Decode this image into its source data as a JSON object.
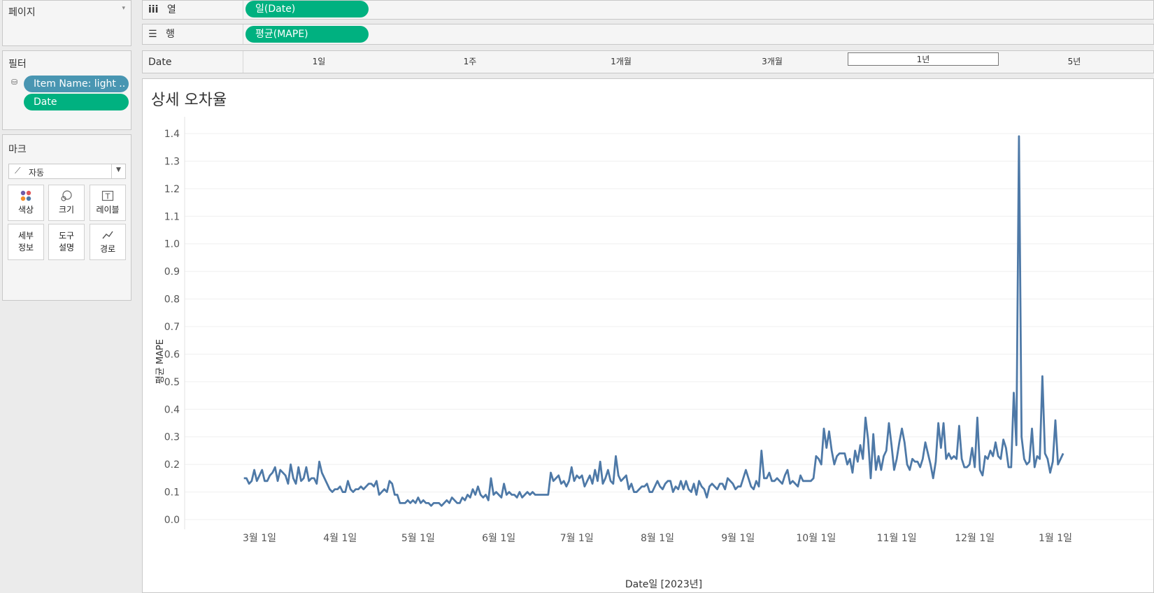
{
  "pages_panel": {
    "title": "페이지"
  },
  "filters_panel": {
    "title": "필터",
    "pills": [
      "Item Name: light ..",
      "Date"
    ]
  },
  "marks_panel": {
    "title": "마크",
    "type_value": "자동",
    "buttons": {
      "color": "색상",
      "size": "크기",
      "label": "레이블",
      "detail": [
        "세부",
        "정보"
      ],
      "tooltip": [
        "도구",
        "설명"
      ],
      "path": "경로"
    }
  },
  "columns_shelf": {
    "icon": "iii",
    "label": "열",
    "pill": "일(Date)"
  },
  "rows_shelf": {
    "icon": "☰",
    "label": "행",
    "pill": "평균(MAPE)"
  },
  "date_slider": {
    "label": "Date",
    "options": [
      "1일",
      "1주",
      "1개월",
      "3개월",
      "1년",
      "5년"
    ],
    "selected_index": 4
  },
  "worksheet": {
    "title": "상세 오차율"
  },
  "colors": {
    "line": "#4e79a7",
    "green_pill": "#00b180",
    "blue_pill": "#4996b2"
  },
  "chart_data": {
    "type": "line",
    "xlabel": "Date일 [2023년]",
    "ylabel": "평균 MAPE",
    "ylim": [
      0,
      1.45
    ],
    "yticks": [
      "0.0",
      "0.1",
      "0.2",
      "0.3",
      "0.4",
      "0.5",
      "0.6",
      "0.7",
      "0.8",
      "0.9",
      "1.0",
      "1.1",
      "1.2",
      "1.3",
      "1.4"
    ],
    "xticks": [
      {
        "label": "3월 1일",
        "date": "2023-03-01"
      },
      {
        "label": "4월 1일",
        "date": "2023-04-01"
      },
      {
        "label": "5월 1일",
        "date": "2023-05-01"
      },
      {
        "label": "6월 1일",
        "date": "2023-06-01"
      },
      {
        "label": "7월 1일",
        "date": "2023-07-01"
      },
      {
        "label": "8월 1일",
        "date": "2023-08-01"
      },
      {
        "label": "9월 1일",
        "date": "2023-09-01"
      },
      {
        "label": "10월 1일",
        "date": "2023-10-01"
      },
      {
        "label": "11월 1일",
        "date": "2023-11-01"
      },
      {
        "label": "12월 1일",
        "date": "2023-12-01"
      },
      {
        "label": "1월 1일",
        "date": "2024-01-01"
      }
    ],
    "series": [
      {
        "start_date": "2023-02-23",
        "values": [
          0.15,
          0.15,
          0.13,
          0.14,
          0.18,
          0.14,
          0.16,
          0.18,
          0.14,
          0.14,
          0.16,
          0.17,
          0.19,
          0.14,
          0.18,
          0.17,
          0.16,
          0.13,
          0.2,
          0.15,
          0.13,
          0.19,
          0.14,
          0.15,
          0.19,
          0.14,
          0.15,
          0.15,
          0.13,
          0.21,
          0.17,
          0.15,
          0.13,
          0.11,
          0.1,
          0.11,
          0.11,
          0.12,
          0.1,
          0.1,
          0.14,
          0.11,
          0.1,
          0.11,
          0.11,
          0.12,
          0.11,
          0.12,
          0.13,
          0.13,
          0.12,
          0.14,
          0.09,
          0.1,
          0.11,
          0.1,
          0.14,
          0.13,
          0.09,
          0.09,
          0.06,
          0.06,
          0.06,
          0.07,
          0.06,
          0.07,
          0.06,
          0.08,
          0.06,
          0.07,
          0.06,
          0.06,
          0.05,
          0.06,
          0.06,
          0.06,
          0.05,
          0.06,
          0.07,
          0.06,
          0.08,
          0.07,
          0.06,
          0.06,
          0.08,
          0.07,
          0.09,
          0.08,
          0.11,
          0.09,
          0.12,
          0.09,
          0.08,
          0.09,
          0.07,
          0.15,
          0.09,
          0.1,
          0.09,
          0.08,
          0.13,
          0.09,
          0.1,
          0.09,
          0.09,
          0.08,
          0.1,
          0.08,
          0.09,
          0.1,
          0.09,
          0.1,
          0.09,
          0.09,
          0.09,
          0.09,
          0.09,
          0.09,
          0.17,
          0.14,
          0.15,
          0.16,
          0.13,
          0.14,
          0.12,
          0.14,
          0.19,
          0.14,
          0.16,
          0.15,
          0.16,
          0.12,
          0.14,
          0.16,
          0.13,
          0.18,
          0.14,
          0.21,
          0.13,
          0.15,
          0.18,
          0.14,
          0.13,
          0.23,
          0.16,
          0.14,
          0.15,
          0.16,
          0.11,
          0.13,
          0.1,
          0.1,
          0.11,
          0.12,
          0.12,
          0.13,
          0.1,
          0.1,
          0.12,
          0.14,
          0.12,
          0.11,
          0.13,
          0.14,
          0.14,
          0.1,
          0.12,
          0.11,
          0.14,
          0.11,
          0.14,
          0.11,
          0.1,
          0.13,
          0.09,
          0.14,
          0.12,
          0.11,
          0.08,
          0.12,
          0.13,
          0.12,
          0.11,
          0.13,
          0.13,
          0.11,
          0.15,
          0.14,
          0.13,
          0.11,
          0.12,
          0.12,
          0.15,
          0.18,
          0.15,
          0.12,
          0.11,
          0.14,
          0.12,
          0.25,
          0.15,
          0.15,
          0.17,
          0.14,
          0.14,
          0.15,
          0.14,
          0.13,
          0.16,
          0.18,
          0.13,
          0.14,
          0.13,
          0.12,
          0.16,
          0.14,
          0.14,
          0.14,
          0.14,
          0.15,
          0.23,
          0.22,
          0.2,
          0.33,
          0.26,
          0.32,
          0.25,
          0.2,
          0.23,
          0.24,
          0.24,
          0.24,
          0.2,
          0.22,
          0.17,
          0.25,
          0.21,
          0.27,
          0.22,
          0.37,
          0.29,
          0.15,
          0.31,
          0.18,
          0.23,
          0.18,
          0.23,
          0.25,
          0.35,
          0.27,
          0.18,
          0.22,
          0.28,
          0.33,
          0.28,
          0.2,
          0.18,
          0.22,
          0.21,
          0.21,
          0.19,
          0.22,
          0.28,
          0.24,
          0.2,
          0.15,
          0.21,
          0.35,
          0.26,
          0.35,
          0.22,
          0.24,
          0.22,
          0.23,
          0.22,
          0.34,
          0.22,
          0.19,
          0.19,
          0.2,
          0.26,
          0.19,
          0.37,
          0.18,
          0.16,
          0.23,
          0.22,
          0.25,
          0.23,
          0.28,
          0.23,
          0.22,
          0.29,
          0.26,
          0.19,
          0.19,
          0.46,
          0.27,
          1.39,
          0.3,
          0.22,
          0.2,
          0.21,
          0.33,
          0.19,
          0.23,
          0.22,
          0.52,
          0.24,
          0.22,
          0.17,
          0.21,
          0.36,
          0.2,
          0.22,
          0.24
        ]
      }
    ]
  }
}
